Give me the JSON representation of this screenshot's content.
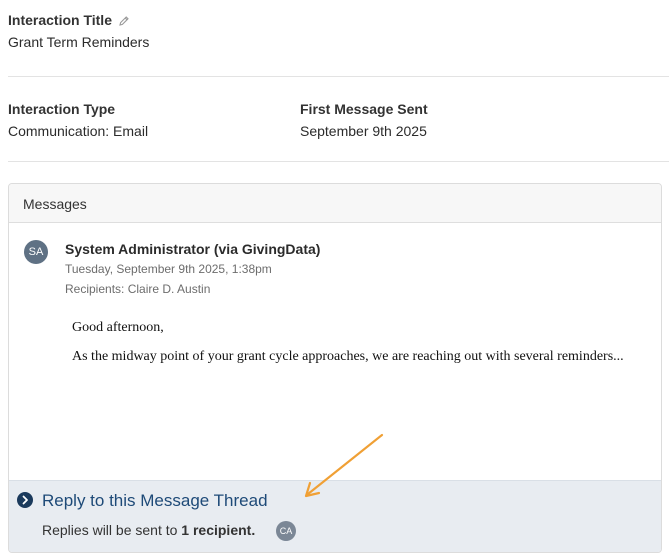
{
  "interaction_title": {
    "label": "Interaction Title",
    "value": "Grant Term Reminders"
  },
  "interaction_type": {
    "label": "Interaction Type",
    "value": "Communication: Email"
  },
  "first_message_sent": {
    "label": "First Message Sent",
    "value": "September 9th 2025"
  },
  "messages": {
    "header": "Messages",
    "items": [
      {
        "avatar_initials": "SA",
        "sender": "System Administrator (via GivingData)",
        "timestamp": "Tuesday, September 9th 2025, 1:38pm",
        "recipients": "Recipients: Claire D. Austin",
        "greeting": "Good afternoon,",
        "body": "As the midway point of your grant cycle approaches, we are reaching out with several reminders..."
      }
    ]
  },
  "reply": {
    "link_text": "Reply to this Message Thread",
    "note_prefix": "Replies will be sent to ",
    "note_count": "1 recipient.",
    "recipient_initials": "CA"
  },
  "icons": {
    "edit": "pencil-icon",
    "reply": "chevron-right-circle-icon",
    "annotation": "arrow-annotation"
  },
  "colors": {
    "link": "#1e4a78",
    "reply_background": "#e8ecf1",
    "avatar": "#5f7184",
    "annotation_arrow": "#f0a035"
  }
}
